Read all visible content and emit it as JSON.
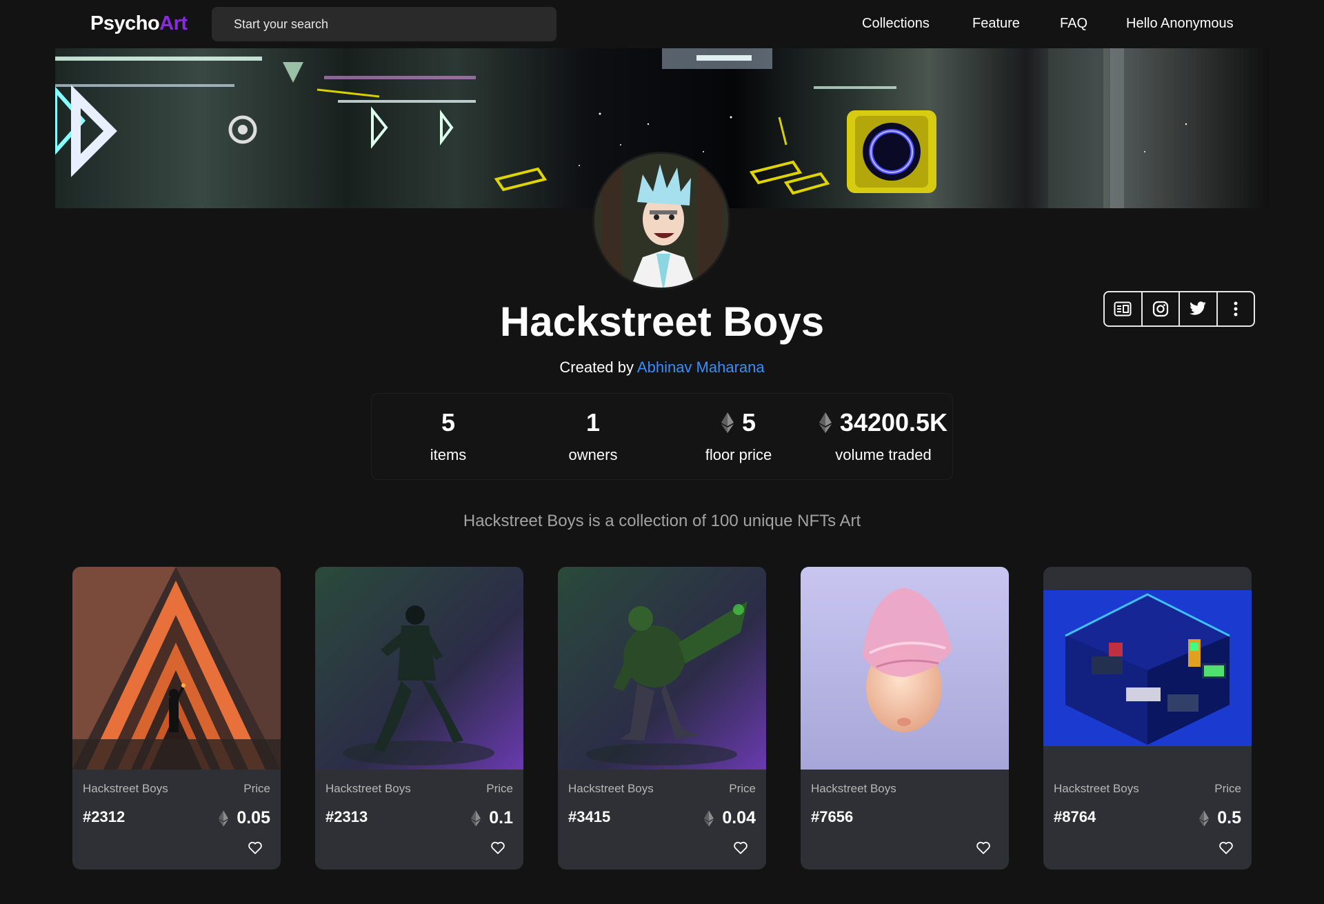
{
  "nav": {
    "logo_main": "Psycho",
    "logo_accent": "Art",
    "search_placeholder": "Start your search",
    "links": [
      "Collections",
      "Feature",
      "FAQ",
      "Hello Anonymous"
    ]
  },
  "collection": {
    "title": "Hackstreet Boys",
    "created_prefix": "Created by",
    "creator": "Abhinav Maharana",
    "description": "Hackstreet Boys is a collection of 100 unique NFTs Art",
    "social_icons": [
      "website-icon",
      "instagram-icon",
      "twitter-icon",
      "more-vertical-icon"
    ]
  },
  "stats": [
    {
      "value": "5",
      "label": "items",
      "eth": false
    },
    {
      "value": "1",
      "label": "owners",
      "eth": false
    },
    {
      "value": "5",
      "label": "floor price",
      "eth": true
    },
    {
      "value": "34200.5K",
      "label": "volume traded",
      "eth": true
    }
  ],
  "cards": [
    {
      "collection": "Hackstreet Boys",
      "price_label": "Price",
      "token": "#2312",
      "price": "0.05",
      "art": "triangle-corridor"
    },
    {
      "collection": "Hackstreet Boys",
      "price_label": "Price",
      "token": "#2313",
      "price": "0.1",
      "art": "ninja-figure"
    },
    {
      "collection": "Hackstreet Boys",
      "price_label": "Price",
      "token": "#3415",
      "price": "0.04",
      "art": "green-monster"
    },
    {
      "collection": "Hackstreet Boys",
      "price_label": "",
      "token": "#7656",
      "price": "",
      "art": "pink-head"
    },
    {
      "collection": "Hackstreet Boys",
      "price_label": "Price",
      "token": "#8764",
      "price": "0.5",
      "art": "isometric-room"
    }
  ],
  "colors": {
    "background": "#131313",
    "accent": "#8a2be2",
    "link": "#3b8cff",
    "card": "#2f3035"
  }
}
